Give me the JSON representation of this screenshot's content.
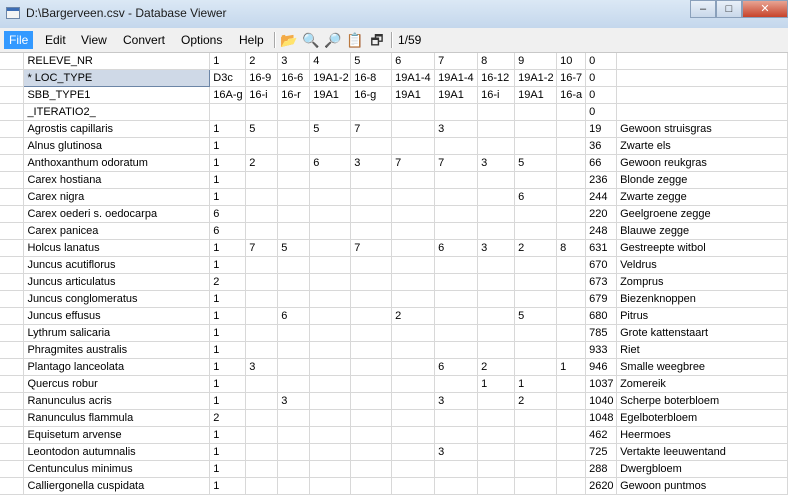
{
  "window": {
    "title": "D:\\Bargerveen.csv - Database Viewer",
    "buttons": [
      "–",
      "□",
      "✕"
    ]
  },
  "menu": [
    "File",
    "Edit",
    "View",
    "Convert",
    "Options",
    "Help"
  ],
  "toolbar": {
    "icons": [
      "open-folder-icon",
      "find-icon",
      "find-replace-icon",
      "properties-icon",
      "window-icon"
    ],
    "glyphs": [
      "📂",
      "🔍",
      "🔎",
      "📋",
      "🗗"
    ],
    "page_indicator": "1/59"
  },
  "columns": [
    "RELEVE_NR",
    "1",
    "2",
    "3",
    "4",
    "5",
    "6",
    "7",
    "8",
    "9",
    "10",
    "0",
    ""
  ],
  "rows": [
    [
      "* LOC_TYPE",
      "D3c",
      "16-9",
      "16-6",
      "19A1-2",
      "16-8",
      "19A1-4",
      "19A1-4",
      "16-12",
      "19A1-2",
      "16-7",
      "0",
      ""
    ],
    [
      "SBB_TYPE1",
      "16A-g",
      "16-i",
      "16-r",
      "19A1",
      "16-g",
      "19A1",
      "19A1",
      "16-i",
      "19A1",
      "16-a",
      "0",
      ""
    ],
    [
      "_ITERATIO2_",
      "",
      "",
      "",
      "",
      "",
      "",
      "",
      "",
      "",
      "",
      "0",
      ""
    ],
    [
      "Agrostis capillaris",
      "1",
      "5",
      "",
      "5",
      "7",
      "",
      "3",
      "",
      "",
      "",
      "19",
      "Gewoon struisgras"
    ],
    [
      "Alnus glutinosa",
      "1",
      "",
      "",
      "",
      "",
      "",
      "",
      "",
      "",
      "",
      "36",
      "Zwarte els"
    ],
    [
      "Anthoxanthum odoratum",
      "1",
      "2",
      "",
      "6",
      "3",
      "7",
      "7",
      "3",
      "5",
      "",
      "66",
      "Gewoon reukgras"
    ],
    [
      "Carex hostiana",
      "1",
      "",
      "",
      "",
      "",
      "",
      "",
      "",
      "",
      "",
      "236",
      "Blonde zegge"
    ],
    [
      "Carex nigra",
      "1",
      "",
      "",
      "",
      "",
      "",
      "",
      "",
      "6",
      "",
      "244",
      "Zwarte zegge"
    ],
    [
      "Carex oederi s. oedocarpa",
      "6",
      "",
      "",
      "",
      "",
      "",
      "",
      "",
      "",
      "",
      "220",
      "Geelgroene zegge"
    ],
    [
      "Carex panicea",
      "6",
      "",
      "",
      "",
      "",
      "",
      "",
      "",
      "",
      "",
      "248",
      "Blauwe zegge"
    ],
    [
      "Holcus lanatus",
      "1",
      "7",
      "5",
      "",
      "7",
      "",
      "6",
      "3",
      "2",
      "8",
      "631",
      "Gestreepte witbol"
    ],
    [
      "Juncus acutiflorus",
      "1",
      "",
      "",
      "",
      "",
      "",
      "",
      "",
      "",
      "",
      "670",
      "Veldrus"
    ],
    [
      "Juncus articulatus",
      "2",
      "",
      "",
      "",
      "",
      "",
      "",
      "",
      "",
      "",
      "673",
      "Zomprus"
    ],
    [
      "Juncus conglomeratus",
      "1",
      "",
      "",
      "",
      "",
      "",
      "",
      "",
      "",
      "",
      "679",
      "Biezenknoppen"
    ],
    [
      "Juncus effusus",
      "1",
      "",
      "6",
      "",
      "",
      "2",
      "",
      "",
      "5",
      "",
      "680",
      "Pitrus"
    ],
    [
      "Lythrum salicaria",
      "1",
      "",
      "",
      "",
      "",
      "",
      "",
      "",
      "",
      "",
      "785",
      "Grote kattenstaart"
    ],
    [
      "Phragmites australis",
      "1",
      "",
      "",
      "",
      "",
      "",
      "",
      "",
      "",
      "",
      "933",
      "Riet"
    ],
    [
      "Plantago lanceolata",
      "1",
      "3",
      "",
      "",
      "",
      "",
      "6",
      "2",
      "",
      "1",
      "946",
      "Smalle weegbree"
    ],
    [
      "Quercus robur",
      "1",
      "",
      "",
      "",
      "",
      "",
      "",
      "1",
      "1",
      "",
      "1037",
      "Zomereik"
    ],
    [
      "Ranunculus acris",
      "1",
      "",
      "3",
      "",
      "",
      "",
      "3",
      "",
      "2",
      "",
      "1040",
      "Scherpe boterbloem"
    ],
    [
      "Ranunculus flammula",
      "2",
      "",
      "",
      "",
      "",
      "",
      "",
      "",
      "",
      "",
      "1048",
      "Egelboterbloem"
    ],
    [
      "Equisetum arvense",
      "1",
      "",
      "",
      "",
      "",
      "",
      "",
      "",
      "",
      "",
      "462",
      "Heermoes"
    ],
    [
      "Leontodon autumnalis",
      "1",
      "",
      "",
      "",
      "",
      "",
      "3",
      "",
      "",
      "",
      "725",
      "Vertakte leeuwentand"
    ],
    [
      "Centunculus minimus",
      "1",
      "",
      "",
      "",
      "",
      "",
      "",
      "",
      "",
      "",
      "288",
      "Dwergbloem"
    ],
    [
      "Calliergonella cuspidata",
      "1",
      "",
      "",
      "",
      "",
      "",
      "",
      "",
      "",
      "",
      "2620",
      "Gewoon puntmos"
    ]
  ]
}
